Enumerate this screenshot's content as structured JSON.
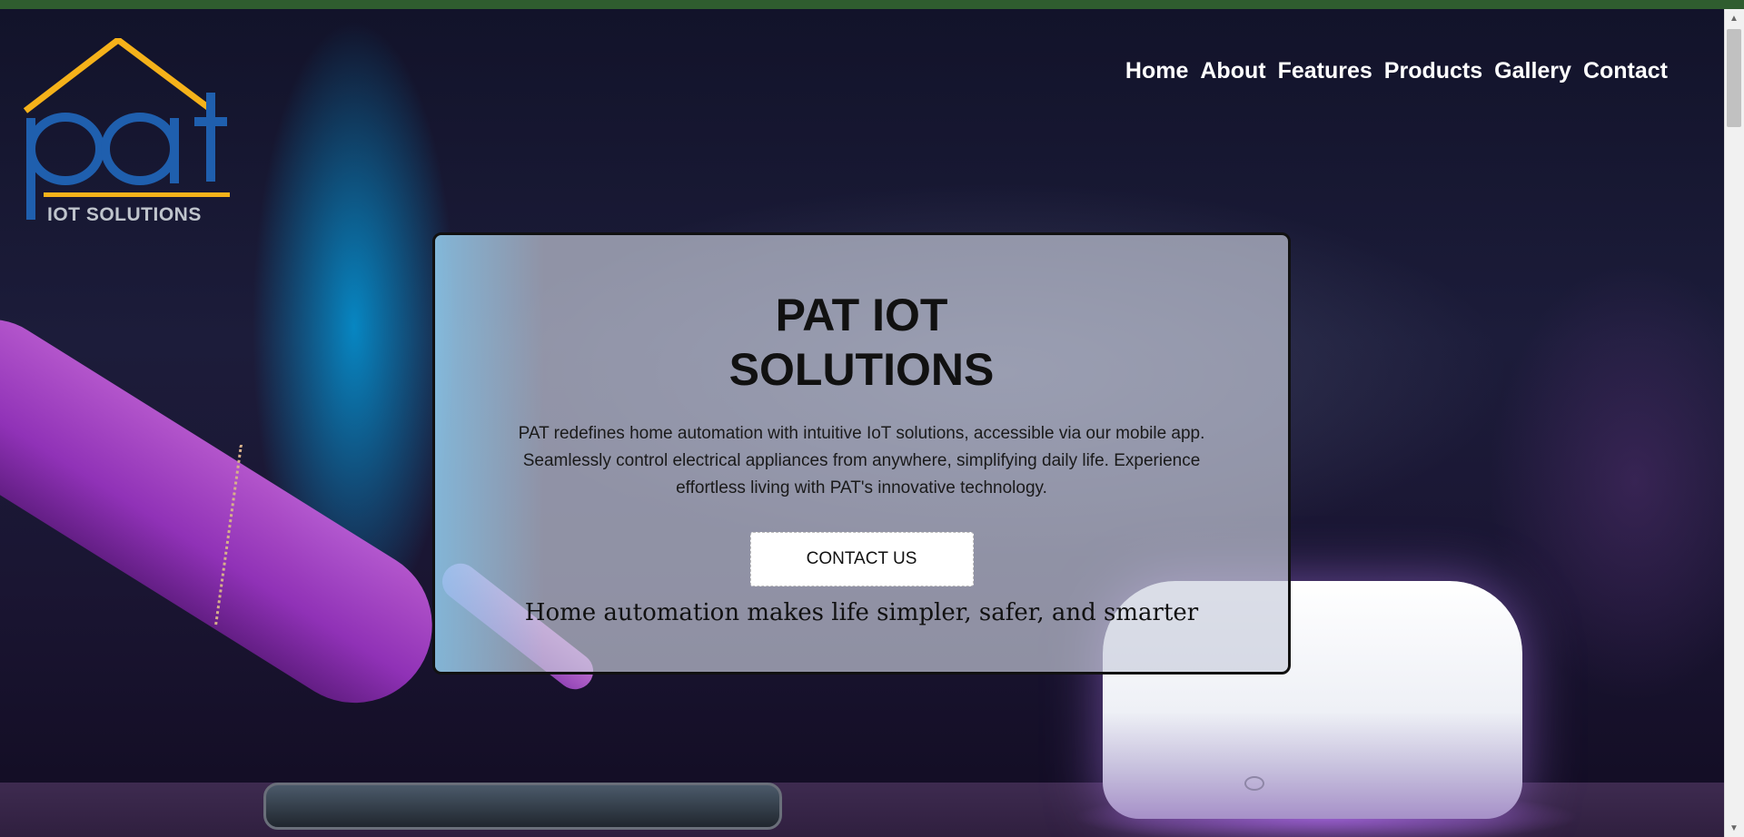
{
  "logo": {
    "mark_text": "pat",
    "tagline": "IOT SOLUTIONS",
    "colors": {
      "roof": "#f5b21a",
      "letters": "#1f5fae",
      "underline": "#f5b21a",
      "tagline": "#bfc4cc"
    }
  },
  "nav": {
    "items": [
      {
        "label": "Home"
      },
      {
        "label": "About"
      },
      {
        "label": "Features"
      },
      {
        "label": "Products"
      },
      {
        "label": "Gallery"
      },
      {
        "label": "Contact"
      }
    ]
  },
  "hero": {
    "title": "PAT IOT SOLUTIONS",
    "description": "PAT redefines home automation with intuitive IoT solutions, accessible via our mobile app. Seamlessly control electrical appliances from anywhere, simplifying daily life. Experience effortless living with PAT's innovative technology.",
    "cta_label": "CONTACT US",
    "tagline": "Home automation makes life simpler, safer, and smarter"
  },
  "colors": {
    "topbar": "#2f5d2f",
    "nav_text": "#ffffff",
    "card_border": "#111111",
    "cta_bg": "#ffffff"
  },
  "scrollbar": {
    "up_icon": "triangle-up-icon",
    "down_icon": "triangle-down-icon"
  }
}
